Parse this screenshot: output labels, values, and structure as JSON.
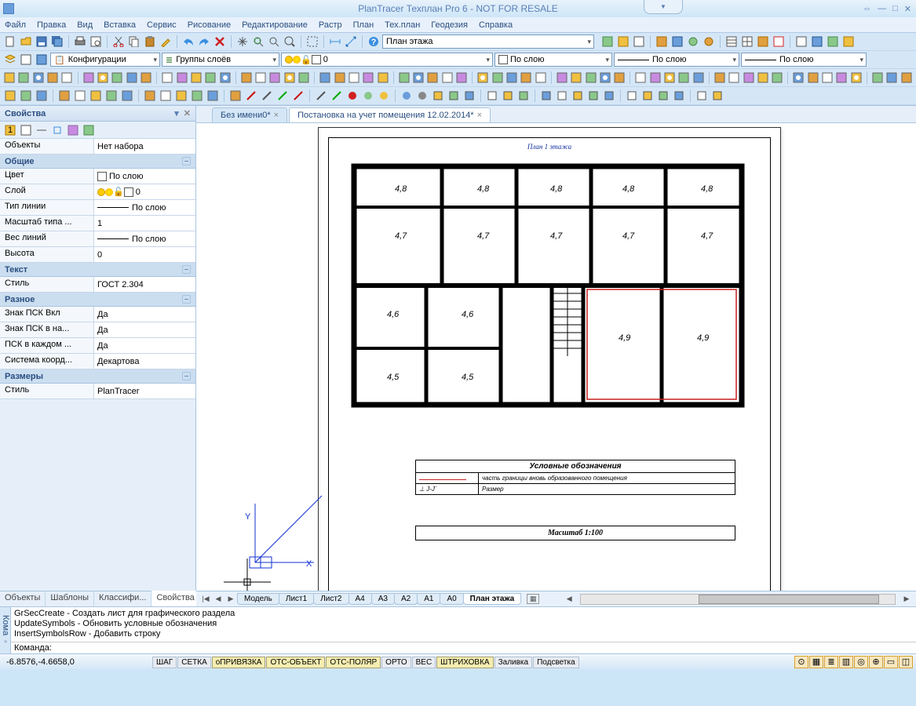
{
  "title": "PlanTracer Техплан Pro 6 - NOT FOR RESALE",
  "menu": [
    "Файл",
    "Правка",
    "Вид",
    "Вставка",
    "Сервис",
    "Рисование",
    "Редактирование",
    "Растр",
    "План",
    "Тех.план",
    "Геодезия",
    "Справка"
  ],
  "toolbar1": {
    "plan_dropdown": "План этажа",
    "config_label": "Конфигурации",
    "groups_label": "Группы слоёв",
    "layer0": "0",
    "bylayer": "По слою"
  },
  "props": {
    "title": "Свойства",
    "objects_key": "Объекты",
    "objects_val": "Нет набора",
    "sections": {
      "general": "Общие",
      "text": "Текст",
      "misc": "Разное",
      "dims": "Размеры"
    },
    "rows": {
      "color_key": "Цвет",
      "color_val": "По слою",
      "layer_key": "Слой",
      "layer_val": "0",
      "ltype_key": "Тип линии",
      "ltype_val": "По слою",
      "ltscale_key": "Масштаб типа ...",
      "ltscale_val": "1",
      "lweight_key": "Вес линий",
      "lweight_val": "По слою",
      "height_key": "Высота",
      "height_val": "0",
      "tstyle_key": "Стиль",
      "tstyle_val": "ГОСТ 2.304",
      "ucs1_key": "Знак ПСК Вкл",
      "ucs1_val": "Да",
      "ucs2_key": "Знак ПСК в на...",
      "ucs2_val": "Да",
      "ucs3_key": "ПСК в каждом ...",
      "ucs3_val": "Да",
      "coord_key": "Система коорд...",
      "coord_val": "Декартова",
      "dstyle_key": "Стиль",
      "dstyle_val": "PlanTracer"
    },
    "tabs": [
      "Объекты ...",
      "Шаблоны",
      "Классифи...",
      "Свойства"
    ]
  },
  "doctabs": [
    {
      "label": "Без имени0*",
      "active": false
    },
    {
      "label": "Постановка на учет помещения 12.02.2014*",
      "active": true
    }
  ],
  "drawing": {
    "title": "План 1 этажа",
    "legend_header": "Условные обозначения",
    "legend_row1": "часть границы вновь образованного помещения",
    "legend_row2_sym": "⊥ J-J´",
    "legend_row2_txt": "Размер",
    "scale": "Масштаб 1:100",
    "axis_x": "X",
    "axis_y": "Y"
  },
  "layout_tabs": [
    "Модель",
    "Лист1",
    "Лист2",
    "A4",
    "A3",
    "A2",
    "A1",
    "A0",
    "План этажа"
  ],
  "cmd": {
    "gutter": "Кома",
    "h1": "GrSecCreate - Создать лист для графического раздела",
    "h2": "UpdateSymbols - Обновить условные обозначения",
    "h3": "InsertSymbolsRow - Добавить строку",
    "prompt": "Команда:"
  },
  "status": {
    "coords": "-6.8576,-4.6658,0",
    "btns": [
      "ШАГ",
      "СЕТКА",
      "оПРИВЯЗКА",
      "ОТС-ОБЪЕКТ",
      "ОТС-ПОЛЯР",
      "ОРТО",
      "ВЕС",
      "ШТРИХОВКА",
      "Заливка",
      "Подсветка"
    ],
    "btns_on": [
      false,
      false,
      true,
      true,
      true,
      false,
      false,
      true,
      false,
      false
    ]
  }
}
